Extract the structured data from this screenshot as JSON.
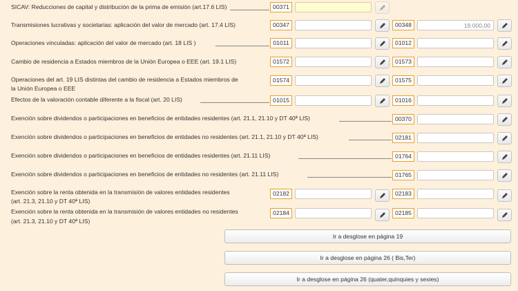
{
  "rows": [
    {
      "label": "SICAV: Reducciones de capital y distribución de la prima de emisión (art.17.6 LIS)",
      "code1": "00371",
      "value1": "",
      "code2": "",
      "value2": ""
    },
    {
      "label": "Transmisiones lucrativas y societarias: aplicación del valor de mercado (art. 17.4 LIS)",
      "code1": "00347",
      "value1": "",
      "code2": "00348",
      "value2": "19.000,00"
    },
    {
      "label": "Operaciones vinculadas: aplicación del valor de mercado (art. 18 LIS )",
      "code1": "01011",
      "value1": "",
      "code2": "01012",
      "value2": ""
    },
    {
      "label": "Cambio de residencia a Estados miembros de la Unión Europea o EEE (art. 19.1 LIS)",
      "code1": "01572",
      "value1": "",
      "code2": "01573",
      "value2": ""
    },
    {
      "label_line1": "Operaciones del art. 19 LIS distintas del cambio de residencia a Estados miembros de",
      "label_line2": "la Unión Europea o EEE",
      "code1": "01574",
      "value1": "",
      "code2": "01575",
      "value2": ""
    },
    {
      "label": "Efectos de la valoración contable diferente a la fiscal (art. 20 LIS)",
      "code1": "01015",
      "value1": "",
      "code2": "01016",
      "value2": ""
    },
    {
      "label": "Exención sobre dividendos o participaciones en beneficios de entidades residentes (art. 21.1, 21.10 y DT 40ª LIS)",
      "code2": "00370",
      "value2": ""
    },
    {
      "label": "Exención sobre dividendos o participaciones en beneficios de entidades no residentes (art. 21.1, 21.10 y DT 40ª LIS)",
      "code2": "02181",
      "value2": ""
    },
    {
      "label": "Exención sobre dividendos o participaciones en beneficios de entidades residentes (art. 21.11 LIS)",
      "code2": "01764",
      "value2": ""
    },
    {
      "label": "Exención sobre dividendos o participaciones en beneficios de entidades no residentes (art. 21.11 LIS)",
      "code2": "01765",
      "value2": ""
    },
    {
      "label_line1": "Exención sobre la renta obtenida en la transmisión de valores entidades residentes",
      "label_line2": "(art. 21.3, 21.10 y DT 40ª LIS)",
      "code1": "02182",
      "value1": "",
      "code2": "02183",
      "value2": ""
    },
    {
      "label_line1": "Exención sobre la renta obtenida en la transmisión de valores entidades no residentes",
      "label_line2": "(art. 21.3, 21.10 y DT 40ª LIS)",
      "code1": "02184",
      "value1": "",
      "code2": "02185",
      "value2": ""
    }
  ],
  "buttons": {
    "b1": "Ir a desglose en página 19",
    "b2": "Ir a desglose en página 26 ( Bis,Ter)",
    "b3": "Ir a desglose en página 26 (quater,quinquies y sexies)"
  },
  "icons": {
    "edit": "pencil-icon"
  }
}
